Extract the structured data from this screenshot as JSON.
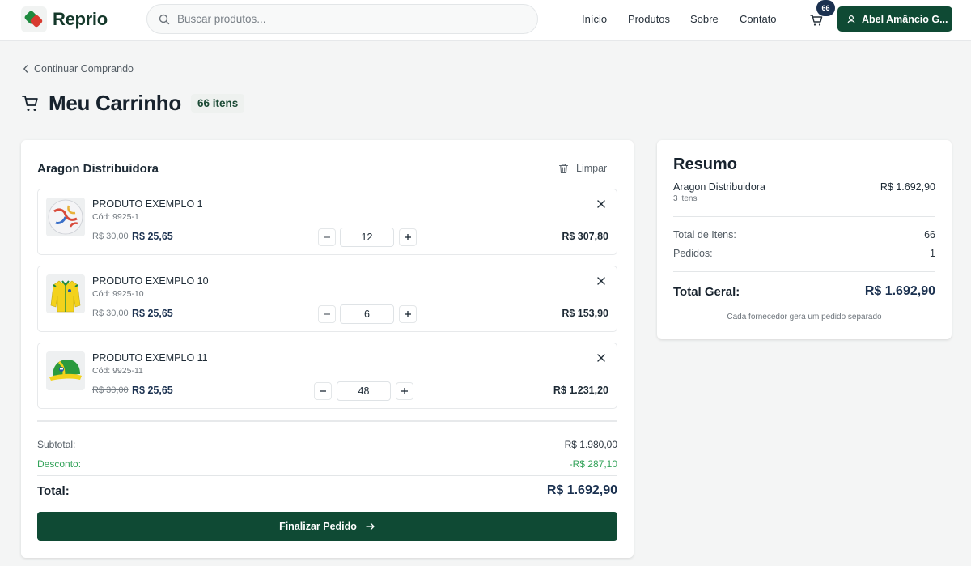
{
  "header": {
    "brand": "Reprio",
    "search_placeholder": "Buscar produtos...",
    "nav": [
      "Início",
      "Produtos",
      "Sobre",
      "Contato"
    ],
    "cart_count": "66",
    "user_name": "Abel Amâncio G..."
  },
  "page": {
    "back_label": "Continuar Comprando",
    "title": "Meu Carrinho",
    "item_count": "66 itens"
  },
  "cart": {
    "supplier": "Aragon Distribuidora",
    "clear_label": "Limpar",
    "items": [
      {
        "name": "PRODUTO EXEMPLO 1",
        "code": "Cód: 9925-1",
        "old_price": "R$ 30,00",
        "price": "R$ 25,65",
        "qty": "12",
        "total": "R$ 307,80",
        "image": "soccer-ball"
      },
      {
        "name": "PRODUTO EXEMPLO 10",
        "code": "Cód: 9925-10",
        "old_price": "R$ 30,00",
        "price": "R$ 25,65",
        "qty": "6",
        "total": "R$ 153,90",
        "image": "yellow-jacket"
      },
      {
        "name": "PRODUTO EXEMPLO 11",
        "code": "Cód: 9925-11",
        "old_price": "R$ 30,00",
        "price": "R$ 25,65",
        "qty": "48",
        "total": "R$ 1.231,20",
        "image": "green-cap"
      }
    ],
    "subtotal_label": "Subtotal:",
    "subtotal": "R$ 1.980,00",
    "discount_label": "Desconto:",
    "discount": "-R$ 287,10",
    "total_label": "Total:",
    "total": "R$ 1.692,90",
    "checkout_label": "Finalizar Pedido"
  },
  "summary": {
    "title": "Resumo",
    "supplier": "Aragon Distribuidora",
    "supplier_items": "3 itens",
    "supplier_total": "R$ 1.692,90",
    "total_items_label": "Total de Itens:",
    "total_items": "66",
    "orders_label": "Pedidos:",
    "orders": "1",
    "grand_total_label": "Total Geral:",
    "grand_total": "R$ 1.692,90",
    "note": "Cada fornecedor gera um pedido separado"
  },
  "colors": {
    "primary": "#0f4a34",
    "price": "#1b3150",
    "discount": "#34a35a",
    "badge": "#1b3150"
  }
}
